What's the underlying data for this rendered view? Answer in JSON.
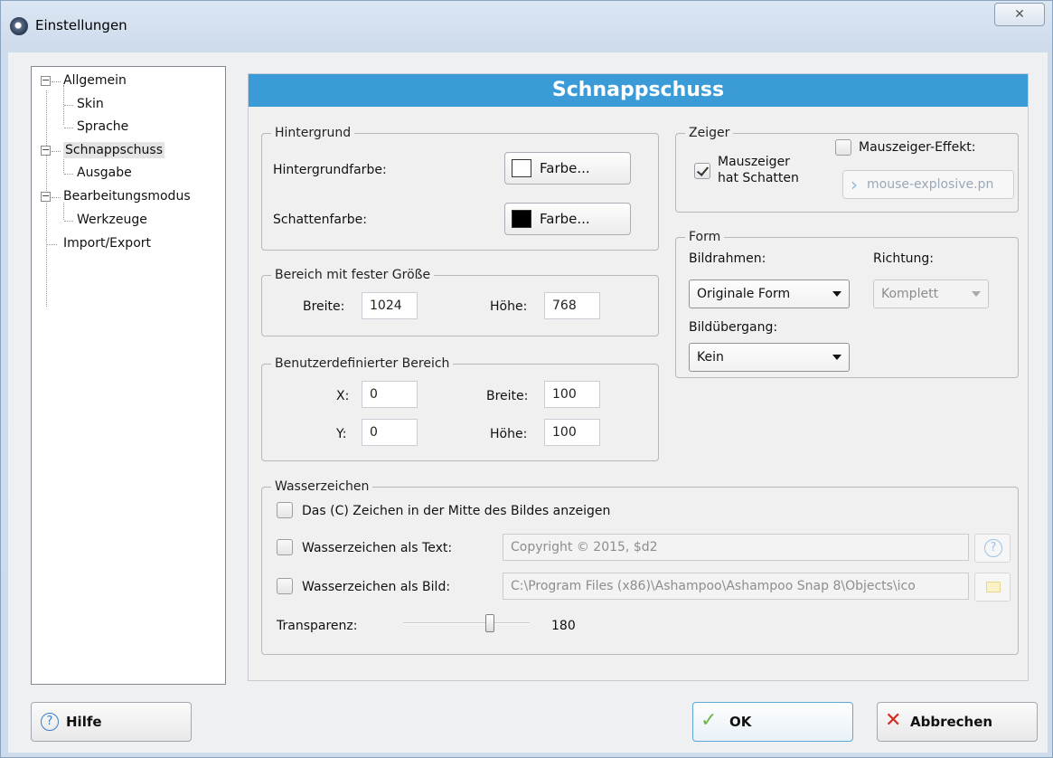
{
  "window": {
    "title": "Einstellungen",
    "close_glyph": "✕"
  },
  "tree": {
    "items": [
      {
        "label": "Allgemein",
        "expander": "−"
      },
      {
        "label": "Skin"
      },
      {
        "label": "Sprache"
      },
      {
        "label": "Schnappschuss",
        "expander": "−",
        "selected": true
      },
      {
        "label": "Ausgabe"
      },
      {
        "label": "Bearbeitungsmodus",
        "expander": "−"
      },
      {
        "label": "Werkzeuge"
      },
      {
        "label": "Import/Export"
      }
    ]
  },
  "panel": {
    "title": "Schnappschuss",
    "background": {
      "title": "Hintergrund",
      "bg_color_label": "Hintergrundfarbe:",
      "bg_color_button": "Farbe...",
      "bg_color_value": "#ffffff",
      "shadow_color_label": "Schattenfarbe:",
      "shadow_color_button": "Farbe...",
      "shadow_color_value": "#000000"
    },
    "fixed_area": {
      "title": "Bereich mit fester Größe",
      "width_label": "Breite:",
      "width_value": "1024",
      "height_label": "Höhe:",
      "height_value": "768"
    },
    "custom_area": {
      "title": "Benutzerdefinierter Bereich",
      "x_label": "X:",
      "x_value": "0",
      "y_label": "Y:",
      "y_value": "0",
      "width_label": "Breite:",
      "width_value": "100",
      "height_label": "Höhe:",
      "height_value": "100"
    },
    "pointer": {
      "title": "Zeiger",
      "shadow_label_line1": "Mauszeiger",
      "shadow_label_line2": "hat Schatten",
      "shadow_checked": true,
      "effect_label": "Mauszeiger-Effekt:",
      "effect_checked": false,
      "effect_file": "mouse-explosive.pn",
      "effect_chevron": "›"
    },
    "shape": {
      "title": "Form",
      "frame_label": "Bildrahmen:",
      "frame_value": "Originale Form",
      "direction_label": "Richtung:",
      "direction_value": "Komplett",
      "transition_label": "Bildübergang:",
      "transition_value": "Kein"
    },
    "watermark": {
      "title": "Wasserzeichen",
      "center_c_label": "Das (C) Zeichen in der Mitte des Bildes anzeigen",
      "as_text_label": "Wasserzeichen als Text:",
      "as_text_value": "Copyright © 2015, $d2",
      "help_glyph": "?",
      "as_image_label": "Wasserzeichen als Bild:",
      "as_image_value": "C:\\Program Files (x86)\\Ashampoo\\Ashampoo Snap 8\\Objects\\ico",
      "transparency_label": "Transparenz:",
      "transparency_value": "180",
      "transparency_fraction": 0.7
    }
  },
  "buttons": {
    "help": "Hilfe",
    "help_glyph": "?",
    "ok": "OK",
    "ok_glyph": "✓",
    "cancel": "Abbrechen",
    "cancel_glyph": "✕"
  },
  "colors": {
    "accent": "#3b9bd7",
    "ok_check": "#6bb84a",
    "cancel_x": "#d9281e"
  }
}
